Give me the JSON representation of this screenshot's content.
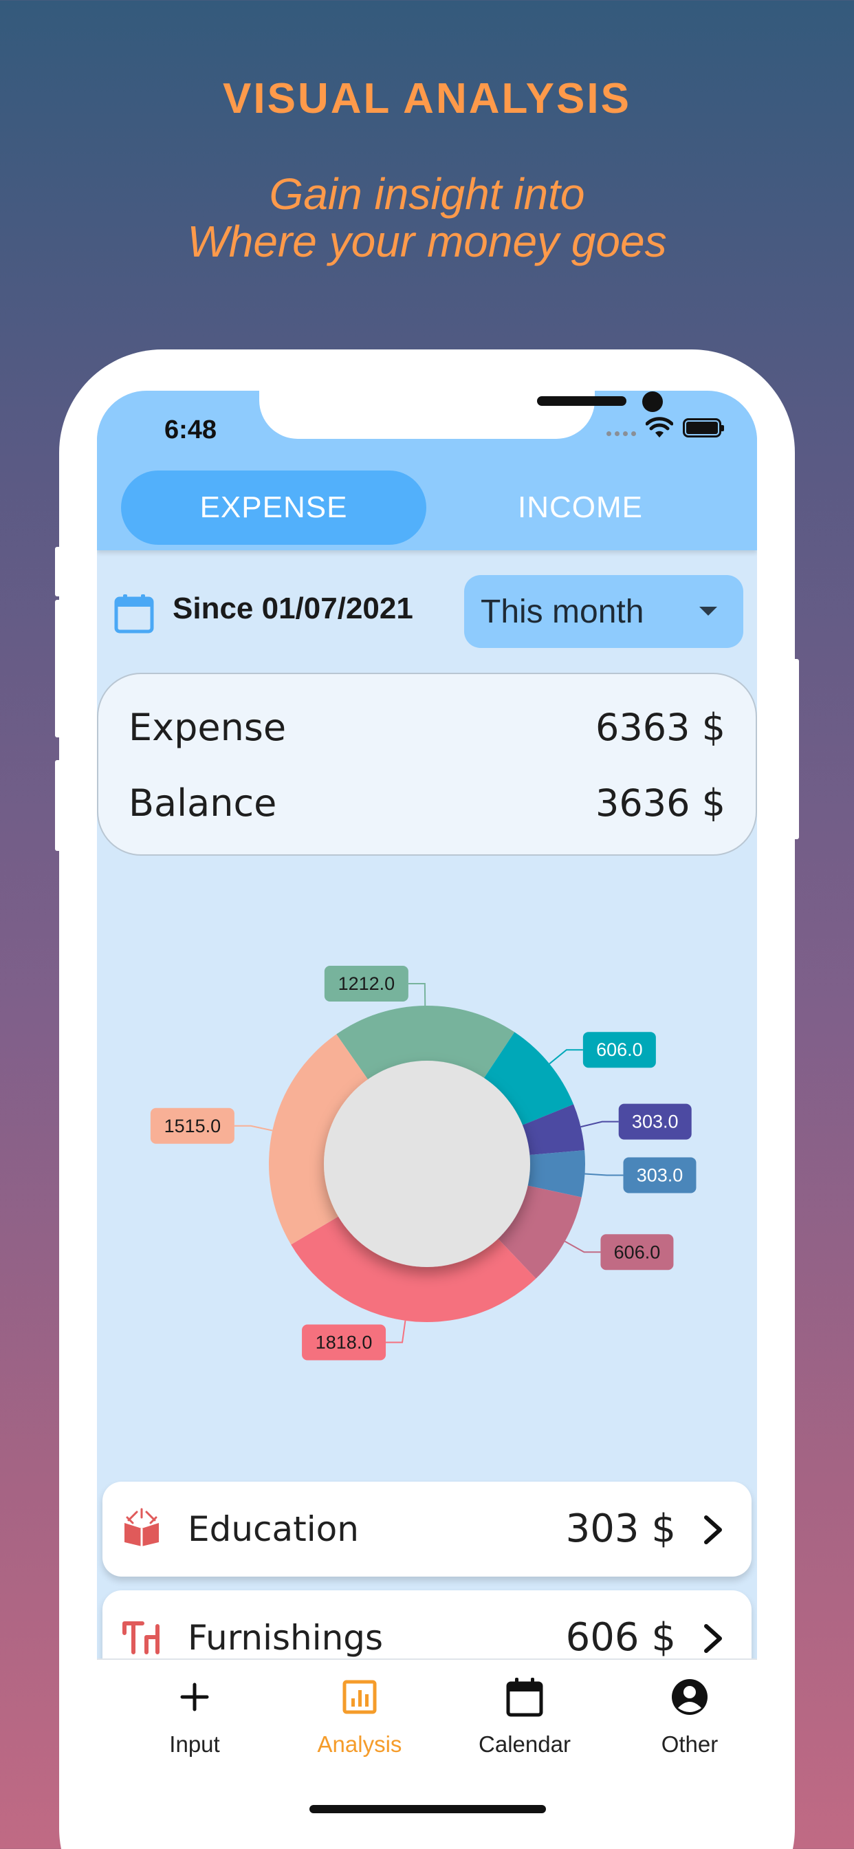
{
  "promo": {
    "title": "VISUAL  ANALYSIS",
    "subtitle_line1": "Gain insight into",
    "subtitle_line2": "Where your money goes"
  },
  "status_bar": {
    "time": "6:48"
  },
  "tabs": [
    {
      "label": "EXPENSE",
      "active": true
    },
    {
      "label": "INCOME",
      "active": false
    }
  ],
  "filter": {
    "since_label": "Since 01/07/2021",
    "period_selected": "This month"
  },
  "summary": {
    "expense_label": "Expense",
    "expense_value": "6363 $",
    "balance_label": "Balance",
    "balance_value": "3636 $"
  },
  "chart_data": {
    "type": "pie",
    "donut": true,
    "values": [
      1212.0,
      606.0,
      303.0,
      303.0,
      606.0,
      1818.0,
      1515.0
    ],
    "labels": [
      "1212.0",
      "606.0",
      "303.0",
      "303.0",
      "606.0",
      "1818.0",
      "1515.0"
    ],
    "colors": [
      "#77b39c",
      "#00a8b8",
      "#4c4aa2",
      "#4a86ba",
      "#c16b84",
      "#f5717e",
      "#f8b096"
    ]
  },
  "categories": [
    {
      "name": "Education",
      "value": "303 $",
      "icon": "book-icon",
      "icon_color": "#e05a5a"
    },
    {
      "name": "Furnishings",
      "value": "606 $",
      "icon": "table-chair-icon",
      "icon_color": "#e05a5a"
    }
  ],
  "nav": [
    {
      "label": "Input",
      "icon": "plus-icon",
      "active": false
    },
    {
      "label": "Analysis",
      "icon": "bar-chart-icon",
      "active": true
    },
    {
      "label": "Calendar",
      "icon": "calendar-icon",
      "active": false
    },
    {
      "label": "Other",
      "icon": "account-circle-icon",
      "active": false
    }
  ],
  "colors": {
    "accent_orange": "#ff9a4a",
    "header_blue": "#8ecbfd",
    "active_tab_blue": "#52b0fb",
    "screen_bg": "#d4e8fa",
    "nav_active": "#f59c2a"
  }
}
